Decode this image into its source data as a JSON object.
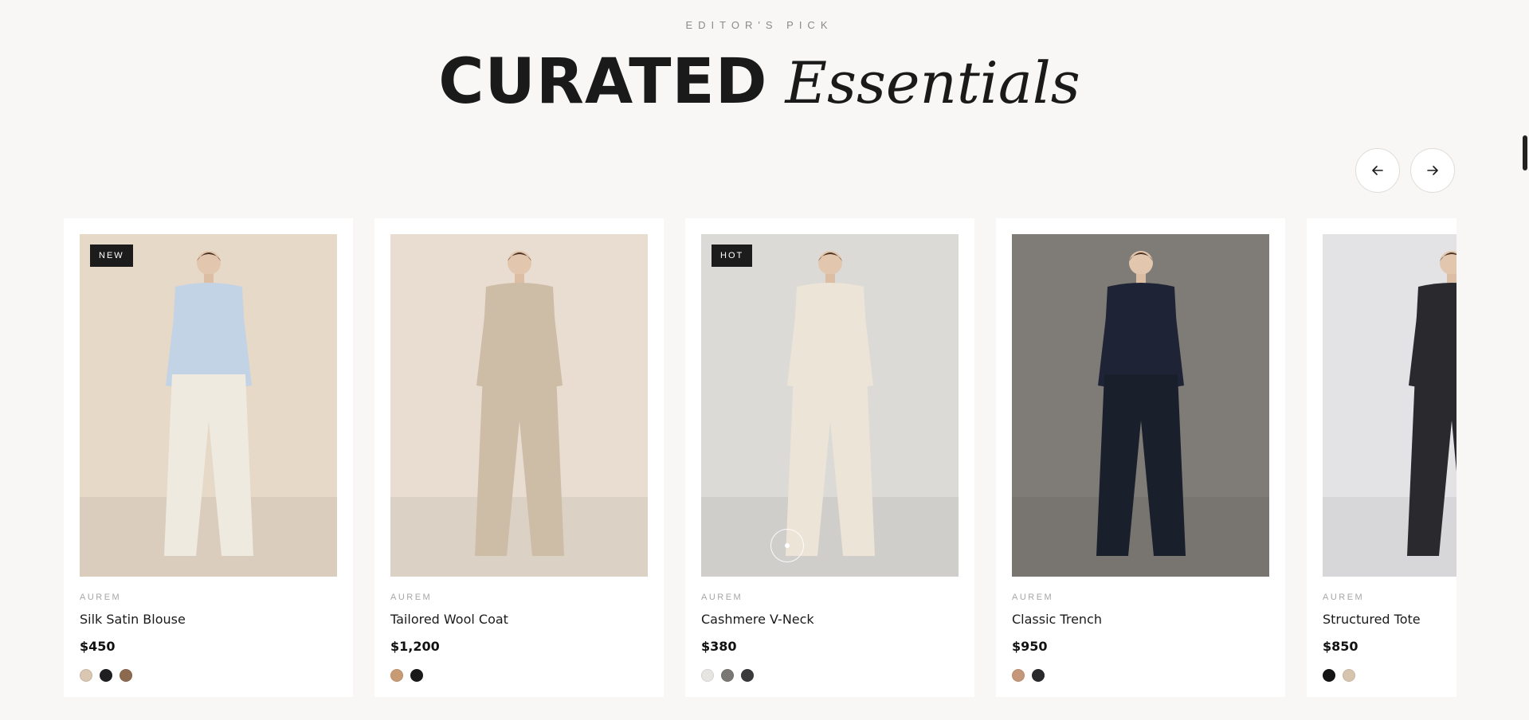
{
  "section": {
    "eyebrow": "EDITOR'S PICK",
    "title_bold": "CURATED",
    "title_script": "Essentials"
  },
  "carousel": {
    "prev_icon": "arrow-left-icon",
    "next_icon": "arrow-right-icon"
  },
  "products": [
    {
      "badge": "NEW",
      "brand": "AUREM",
      "name": "Silk Satin Blouse",
      "price": "$450",
      "photo_bg": "#e6d9c8",
      "top_color": "#c3d3e6",
      "bottom_color": "#efeae0",
      "swatches": [
        "#d9c7b2",
        "#1f1f22",
        "#8b6a50"
      ]
    },
    {
      "badge": "",
      "brand": "AUREM",
      "name": "Tailored Wool Coat",
      "price": "$1,200",
      "photo_bg": "#e8ddd0",
      "top_color": "#cdbca6",
      "bottom_color": "#cdbca6",
      "swatches": [
        "#c89b74",
        "#1a1a1a"
      ]
    },
    {
      "badge": "HOT",
      "brand": "AUREM",
      "name": "Cashmere V-Neck",
      "price": "$380",
      "photo_bg": "#dcdad6",
      "top_color": "#ece4d6",
      "bottom_color": "#ece4d6",
      "swatches": [
        "#e7e5e2",
        "#7a7875",
        "#3a3a3c"
      ]
    },
    {
      "badge": "",
      "brand": "AUREM",
      "name": "Classic Trench",
      "price": "$950",
      "photo_bg": "#7f7c77",
      "top_color": "#1e2436",
      "bottom_color": "#1a1f2c",
      "swatches": [
        "#c4977a",
        "#2a2a2c"
      ]
    },
    {
      "badge": "",
      "brand": "AUREM",
      "name": "Structured Tote",
      "price": "$850",
      "photo_bg": "#e3e3e5",
      "top_color": "#2a2a2e",
      "bottom_color": "#2a2a2e",
      "swatches": [
        "#151515",
        "#d6c4ae"
      ]
    }
  ]
}
